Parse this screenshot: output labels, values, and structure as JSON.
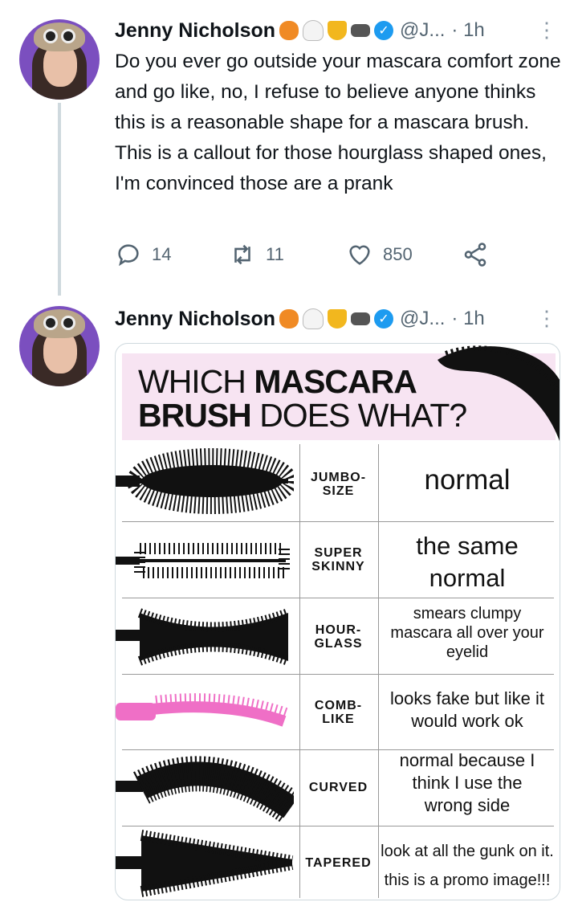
{
  "tweets": [
    {
      "name": "Jenny Nicholson",
      "handle": "@J...",
      "time": "· 1h",
      "text": "Do you ever go outside your mascara comfort zone and go like, no, I refuse to believe anyone thinks this is a reasonable shape for a mascara brush. This is a callout for those hourglass shaped ones, I'm convinced those are a prank",
      "replies": "14",
      "retweets": "11",
      "likes": "850"
    },
    {
      "name": "Jenny Nicholson",
      "handle": "@J...",
      "time": "· 1h"
    }
  ],
  "icons": [
    "pumpkin-emoji",
    "ghost-emoji",
    "trophy-emoji",
    "bat-emoji",
    "verified-badge",
    "more-icon",
    "reply-icon",
    "retweet-icon",
    "like-icon",
    "share-icon"
  ],
  "colors": {
    "verified": "#1d9bf0",
    "meta": "#536471",
    "banner": "#f7e4f2",
    "comb_brush": "#ef6fc6"
  },
  "image": {
    "title_line1_light": "WHICH ",
    "title_line1_bold": "MASCARA",
    "title_line2_bold": "BRUSH",
    "title_line2_light": " DOES WHAT?",
    "rows": [
      {
        "label_l1": "JUMBO-",
        "label_l2": "SIZE",
        "desc": "normal"
      },
      {
        "label_l1": "SUPER",
        "label_l2": "SKINNY",
        "desc_l1": "the same",
        "desc_l2": "normal"
      },
      {
        "label_l1": "HOUR-",
        "label_l2": "GLASS",
        "desc": "smears clumpy mascara all over your eyelid"
      },
      {
        "label_l1": "COMB-",
        "label_l2": "LIKE",
        "desc": "looks fake but like it would work ok"
      },
      {
        "label": "CURVED",
        "desc": "normal because I think I use the wrong side"
      },
      {
        "label": "TAPERED",
        "desc_l1": "look at all the gunk on it.",
        "desc_l2": "this is a promo image!!!"
      }
    ]
  }
}
